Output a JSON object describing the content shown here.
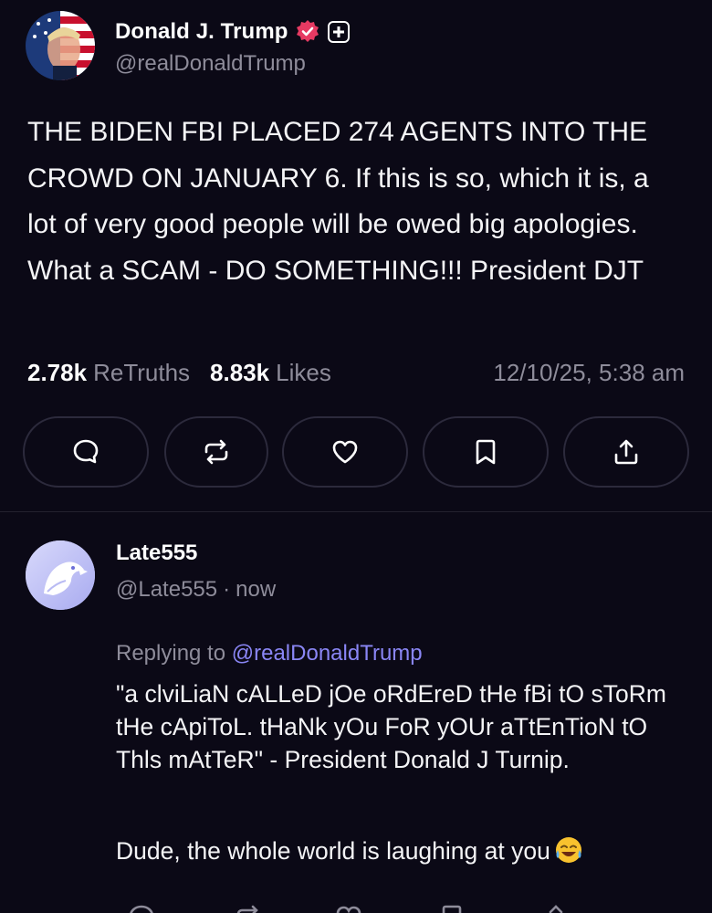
{
  "post": {
    "author_name": "Donald J. Trump",
    "author_handle": "@realDonaldTrump",
    "verified_icon": "verified-check-icon",
    "body": "THE BIDEN FBI PLACED 274 AGENTS INTO THE CROWD ON JANUARY 6. If this is so, which it is, a lot of very good people will be owed big apologies. What a SCAM - DO SOMETHING!!! President DJT",
    "retruths_count": "2.78k",
    "retruths_label": "ReTruths",
    "likes_count": "8.83k",
    "likes_label": "Likes",
    "timestamp": "12/10/25, 5:38 am"
  },
  "actions": [
    "reply-icon",
    "retruth-icon",
    "heart-icon",
    "bookmark-icon",
    "share-icon"
  ],
  "reply": {
    "author_name": "Late555",
    "author_handle": "@Late555",
    "separator": "·",
    "time": "now",
    "replying_prefix": "Replying to",
    "replying_mention": "@realDonaldTrump",
    "body": "\"a clviLiaN cALLeD jOe oRdEreD tHe fBi tO sToRm tHe cApiToL. tHaNk yOu FoR yOUr aTtEnTioN tO Thls mAtTeR\" - President Donald J Turnip.",
    "body2": "Dude, the whole world is laughing at you",
    "emoji": "tears-of-joy-emoji"
  },
  "colors": {
    "background": "#0b0916",
    "muted_text": "#8e8c9a",
    "mention": "#8a86f5",
    "verified": "#e63a62",
    "button_border": "#2c2a3c"
  }
}
